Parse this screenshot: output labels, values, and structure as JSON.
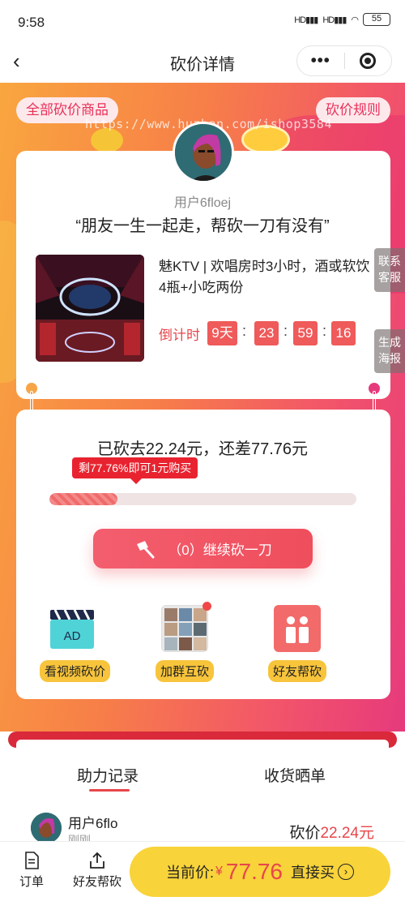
{
  "status_bar": {
    "time": "9:58",
    "signal1": "HD",
    "signal2": "HD",
    "battery": "55"
  },
  "nav": {
    "title": "砍价详情",
    "back_icon": "chevron-left-icon",
    "more_icon": "more-dots-icon",
    "target_icon": "target-icon"
  },
  "hero": {
    "left_pill": "全部砍价商品",
    "right_pill": "砍价规则",
    "watermark": "https://www.huzhan.com/ishop3584"
  },
  "user": {
    "name": "用户6floej",
    "slogan": "“朋友一生一起走，帮砍一刀有没有”"
  },
  "product": {
    "title": "魅KTV | 欢唱房时3小时，酒或软饮4瓶+小吃两份",
    "countdown_label": "倒计时",
    "days": "9天",
    "hours": "23",
    "minutes": "59",
    "seconds": "16",
    "colon": ":"
  },
  "side_buttons": {
    "contact": "联系客服",
    "poster": "生成海报"
  },
  "progress": {
    "summary": "已砍去22.24元，还差77.76元",
    "tip": "剩77.76%即可1元购买",
    "fraction": 0.2224,
    "cta": "（0）继续砍一刀"
  },
  "tools": [
    {
      "label": "看视频砍价",
      "icon": "video-ad-icon",
      "badge": "AD"
    },
    {
      "label": "加群互砍",
      "icon": "group-grid-icon"
    },
    {
      "label": "好友帮砍",
      "icon": "friends-icon"
    }
  ],
  "records": {
    "tabs": [
      "助力记录",
      "收货晒单"
    ],
    "items": [
      {
        "name": "用户6flo",
        "time": "刚刚",
        "amount_label": "砍价",
        "amount": "22.24元"
      }
    ]
  },
  "bottom_bar": {
    "orders": "订单",
    "share": "好友帮砍",
    "buy_label": "当前价:",
    "currency": "¥",
    "price": "77.76",
    "buy_action": "直接买",
    "buy_arrow": "›"
  },
  "colors": {
    "accent": "#e8464b",
    "yellow": "#f8d33a",
    "gradient_start": "#f9a63f",
    "gradient_end": "#e63a7c"
  }
}
